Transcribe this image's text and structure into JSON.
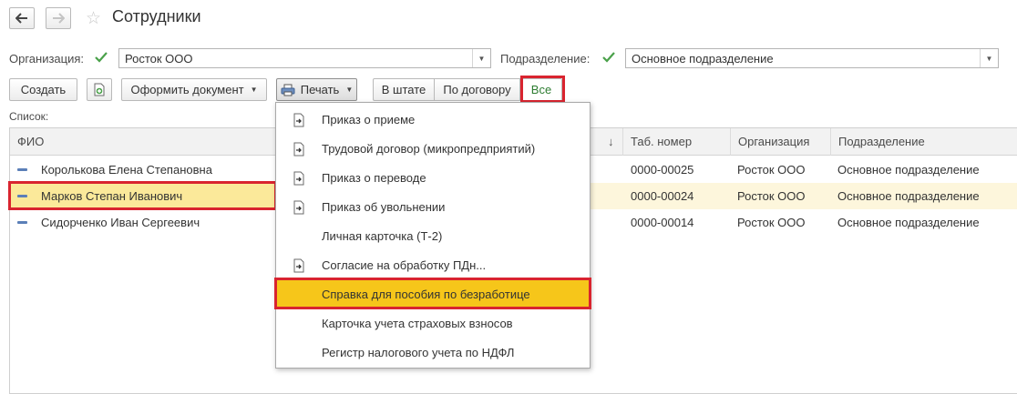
{
  "header": {
    "title": "Сотрудники",
    "back_icon": "arrow-left-icon",
    "forward_icon": "arrow-right-icon",
    "favorite_icon": "star-icon"
  },
  "filters": {
    "organization_label": "Организация:",
    "organization_value": "Росток ООО",
    "department_label": "Подразделение:",
    "department_value": "Основное подразделение"
  },
  "toolbar": {
    "create_label": "Создать",
    "make_document_label": "Оформить документ",
    "print_label": "Печать",
    "in_staff_label": "В штате",
    "by_contract_label": "По договору",
    "all_label": "Все"
  },
  "list": {
    "label": "Список:",
    "columns": {
      "fio": "ФИО",
      "sort_mark": "↓",
      "tab_number": "Таб. номер",
      "organization": "Организация",
      "department": "Подразделение"
    },
    "rows": [
      {
        "fio": "Королькова Елена Степановна",
        "tab_number": "0000-00025",
        "organization": "Росток ООО",
        "department": "Основное подразделение"
      },
      {
        "fio": "Марков Степан Иванович",
        "tab_number": "0000-00024",
        "organization": "Росток ООО",
        "department": "Основное подразделение"
      },
      {
        "fio": "Сидорченко Иван Сергеевич",
        "tab_number": "0000-00014",
        "organization": "Росток ООО",
        "department": "Основное подразделение"
      }
    ]
  },
  "print_menu": {
    "items": [
      {
        "label": "Приказ о приеме",
        "icon": "document-arrow-icon"
      },
      {
        "label": "Трудовой договор (микропредприятий)",
        "icon": "document-arrow-icon"
      },
      {
        "label": "Приказ о переводе",
        "icon": "document-arrow-icon"
      },
      {
        "label": "Приказ об увольнении",
        "icon": "document-arrow-icon"
      },
      {
        "label": "Личная карточка (Т-2)",
        "icon": ""
      },
      {
        "label": "Согласие на обработку ПДн...",
        "icon": "document-arrow-icon"
      },
      {
        "label": "Справка для пособия по безработице",
        "icon": ""
      },
      {
        "label": "Карточка учета страховых взносов",
        "icon": ""
      },
      {
        "label": "Регистр налогового учета по НДФЛ",
        "icon": ""
      }
    ]
  },
  "colors": {
    "selected_row": "#fbe99a",
    "hovered_row": "#fdf6dc",
    "menu_highlight": "#f6c61a",
    "highlight_outline": "#d9242f",
    "checkmark": "#4aa14a",
    "all_button_text": "#2e7d32"
  }
}
